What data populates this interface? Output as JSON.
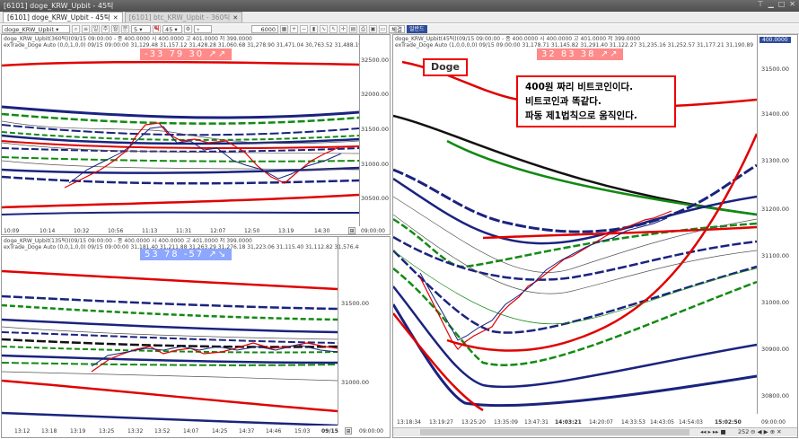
{
  "window": {
    "title": "[6101] doge_KRW_Upbit - 45틱"
  },
  "tabs": [
    {
      "label": "[6101] doge_KRW_Upbit - 45틱",
      "active": true
    },
    {
      "label": "[6101] btc_KRW_Upbit - 360틱",
      "active": false
    }
  ],
  "toolbar": {
    "symbol": "doge_KRW_Upbit",
    "period": "5",
    "tick": "45",
    "count": "6000",
    "btn1": "체결",
    "order": "일반드"
  },
  "top_left": {
    "info1": "doge_KRW_Upbit(360틱)(09/15 09:00:00 - 종 400.0000  시 400.0000  고 401.0000  저 399.0000",
    "info2": "exTrade_Doge Auto  (0,0,1,0,0) 09/15 09:00:00 31,129.48 31,157.12 31,428.28 31,060.68 31,278.90 31,471.04 30,763.52 31,488.19 31,743.24",
    "badge": "-33  79  30  ↗↗",
    "y_ticks": [
      "32500.00",
      "32000.00",
      "31500.00",
      "31000.00",
      "30500.00"
    ],
    "x_ticks": [
      "10:09",
      "10:14",
      "10:32",
      "10:56",
      "11:13",
      "11:31",
      "12:07",
      "12:50",
      "13:19",
      "14:30",
      "09:00:00"
    ]
  },
  "bottom_left": {
    "info1": "doge_KRW_Upbit(135틱)(09/15 09:00:00 - 종 400.0000  시 400.0000  고 401.0000  저 399.0000",
    "info2": "exTrade_Doge Auto  (0,0,1,0,0) 09/15 09:00:00 31,181.40 31,211.88 31,263.29 31,276.18 31,223.06 31,115.40 31,112.82 31,576.48",
    "badge": "53  78  -57  ↗↘",
    "y_ticks": [
      "31500.00",
      "31000.00"
    ],
    "x_ticks": [
      "13:12",
      "13:18",
      "13:19",
      "13:25",
      "13:32",
      "13:52",
      "14:07",
      "14:25",
      "14:37",
      "14:46",
      "15:03",
      "09/15",
      "09:00:00"
    ]
  },
  "right": {
    "info1": "doge_KRW_Upbit(45틱)(09/15 09:00:00 - 종 400.0000  시 400.0000  고 401.0000  저 399.0000",
    "info2": "exTrade_Doge Auto  (1,0,0,0,0) 09/15 09:00:00 31,178.71 31,145.82 31,291.40 31,122.27 31,235.16 31,252.57 31,177.21 31,190.89 31,372.32 30,792.81",
    "badge": "32  83  38  ↗↗",
    "price_tag": "400.0000",
    "doge_label": "Doge",
    "note_lines": [
      "400원 짜리 비트코인이다.",
      "비트코인과 똑같다.",
      "파동 제1법칙으로 움직인다."
    ],
    "y_ticks": [
      "31500.00",
      "31400.00",
      "31300.00",
      "31200.00",
      "31100.00",
      "31000.00",
      "30900.00",
      "30800.00"
    ],
    "x_ticks": [
      "13:18:34",
      "13:19:27",
      "13:25:20",
      "13:35:09",
      "13:47:31",
      "14:03:21",
      "14:20:07",
      "14:33:53",
      "14:43:05",
      "14:54:03",
      "15:02:50",
      "09:00:00"
    ],
    "page_num": "252"
  },
  "colors": {
    "red": "#e00000",
    "blue": "#1a237e",
    "green": "#128a12",
    "black": "#111111",
    "thin": "#555555"
  }
}
